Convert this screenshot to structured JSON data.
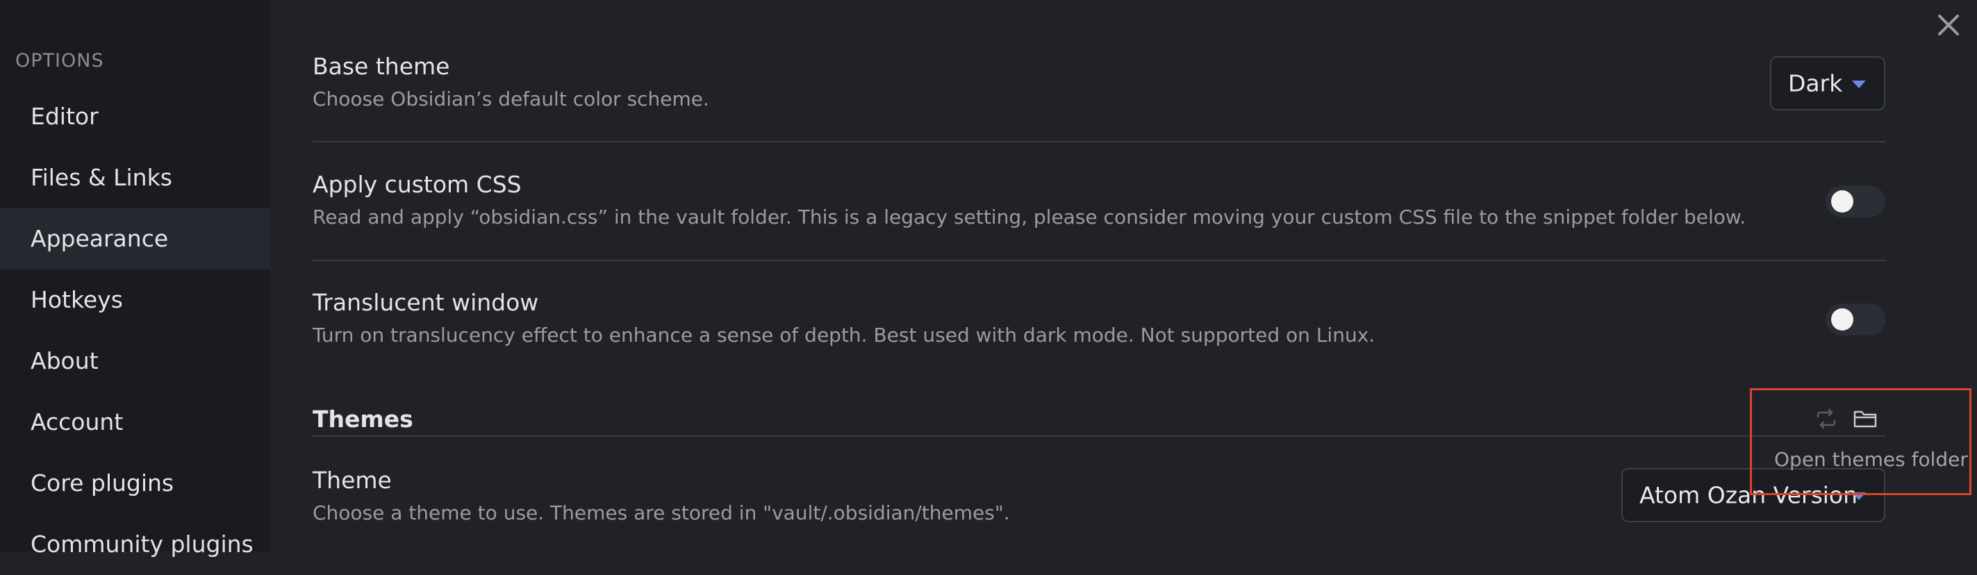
{
  "sidebar": {
    "heading": "OPTIONS",
    "items": [
      {
        "label": "Editor",
        "active": false
      },
      {
        "label": "Files & Links",
        "active": false
      },
      {
        "label": "Appearance",
        "active": true
      },
      {
        "label": "Hotkeys",
        "active": false
      },
      {
        "label": "About",
        "active": false
      },
      {
        "label": "Account",
        "active": false
      },
      {
        "label": "Core plugins",
        "active": false
      },
      {
        "label": "Community plugins",
        "active": false
      }
    ]
  },
  "close_icon": "close-icon",
  "settings": {
    "base_theme": {
      "name": "Base theme",
      "desc": "Choose Obsidian’s default color scheme.",
      "value": "Dark"
    },
    "custom_css": {
      "name": "Apply custom CSS",
      "desc": "Read and apply “obsidian.css” in the vault folder. This is a legacy setting, please consider moving your custom CSS file to the snippet folder below.",
      "enabled": false
    },
    "translucent": {
      "name": "Translucent window",
      "desc": "Turn on translucency effect to enhance a sense of depth. Best used with dark mode. Not supported on Linux.",
      "enabled": false
    }
  },
  "themes": {
    "heading": "Themes",
    "reload_icon": "reload-icon",
    "folder_icon": "folder-icon",
    "tooltip": "Open themes folder",
    "theme": {
      "name": "Theme",
      "desc": "Choose a theme to use. Themes are stored in \"vault/.obsidian/themes\".",
      "value": "Atom Ozan Version"
    }
  },
  "colors": {
    "background": "#202228",
    "sidebar": "#1a1b20",
    "accent": "#6a8ae0",
    "highlight": "#d9452c"
  }
}
